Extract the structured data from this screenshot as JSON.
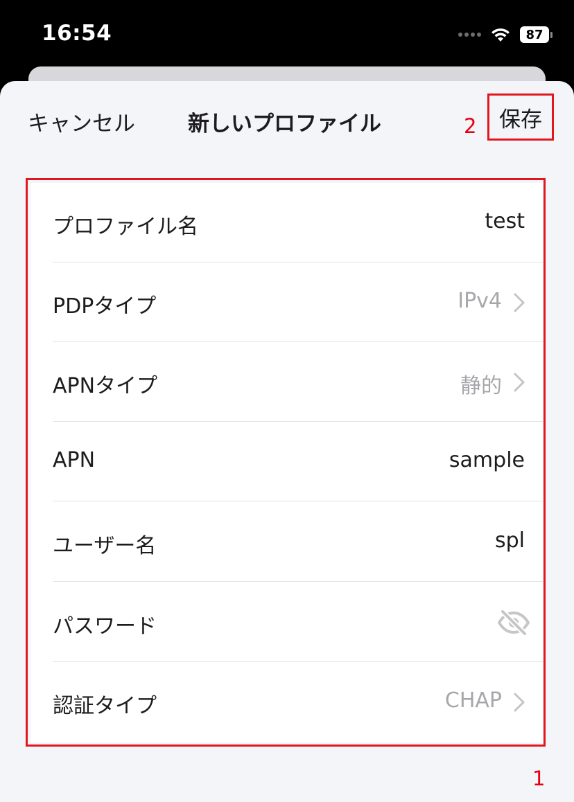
{
  "status_bar": {
    "time": "16:54",
    "battery": "87",
    "icons": [
      "signal-dots-icon",
      "wifi-icon",
      "battery-icon"
    ]
  },
  "nav": {
    "cancel_label": "キャンセル",
    "title": "新しいプロファイル",
    "save_label": "保存"
  },
  "annotations": {
    "save_marker": "2",
    "form_marker": "1",
    "highlight_color": "#e1171e"
  },
  "form": {
    "rows": [
      {
        "label": "プロファイル名",
        "value": "test"
      },
      {
        "label": "PDPタイプ",
        "value": "IPv4",
        "icon": "chevron-right-icon"
      },
      {
        "label": "APNタイプ",
        "value": "静的",
        "icon": "chevron-right-icon"
      },
      {
        "label": "APN",
        "value": "sample"
      },
      {
        "label": "ユーザー名",
        "value": "spl"
      },
      {
        "label": "パスワード",
        "icon": "eye-slash-icon"
      },
      {
        "label": "認証タイプ",
        "value": "CHAP",
        "icon": "chevron-right-icon"
      }
    ]
  }
}
